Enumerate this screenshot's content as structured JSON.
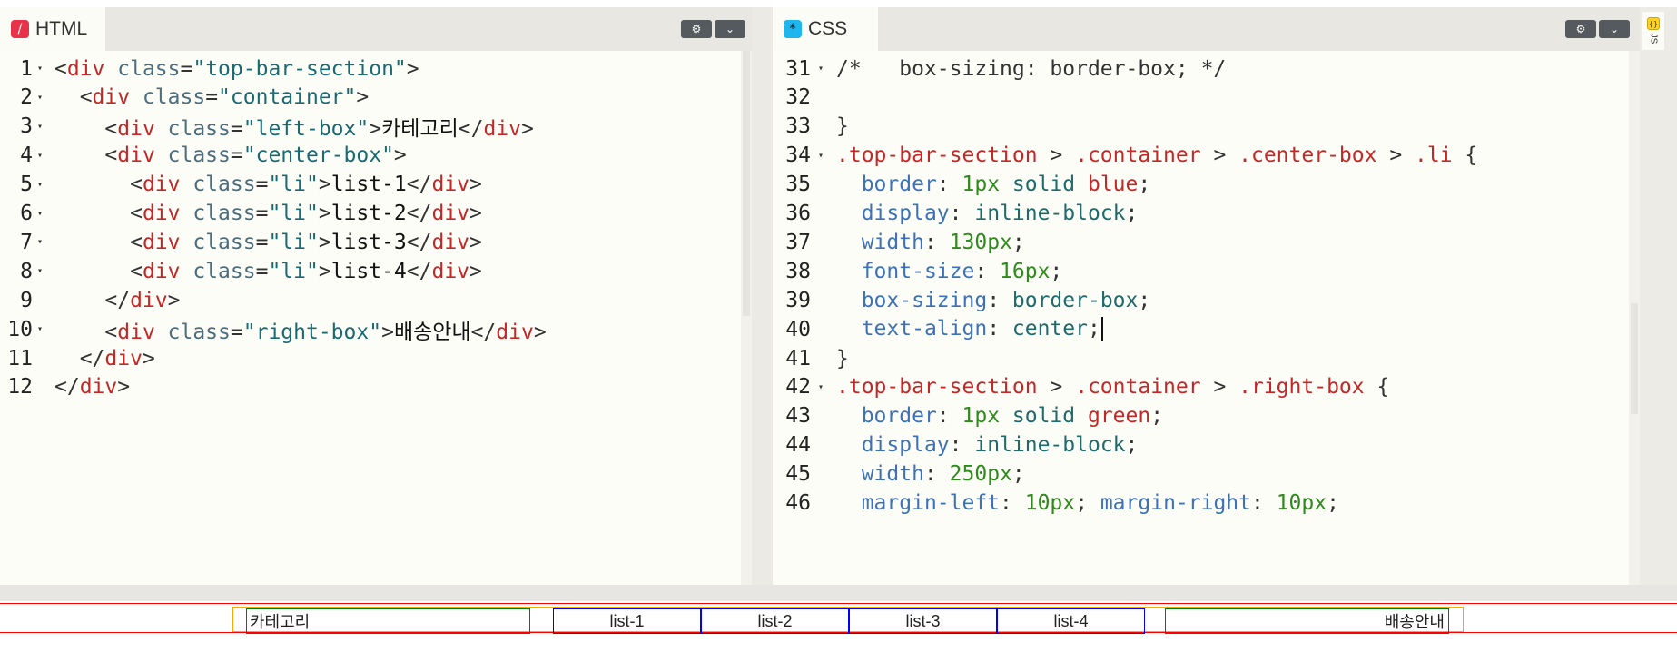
{
  "html_panel": {
    "title": "HTML",
    "icon": "html-file-icon",
    "settings_icon": "gear-icon",
    "menu_icon": "chevron-down-icon",
    "lines": [
      {
        "n": "1",
        "fold": true,
        "tokens": [
          [
            "t-p",
            "<"
          ],
          [
            "t-t",
            "div"
          ],
          [
            "t-a",
            " class"
          ],
          [
            "t-p",
            "="
          ],
          [
            "t-s",
            "\"top-bar-section\""
          ],
          [
            "t-p",
            ">"
          ]
        ]
      },
      {
        "n": "2",
        "fold": true,
        "tokens": [
          [
            "t-p",
            "  <"
          ],
          [
            "t-t",
            "div"
          ],
          [
            "t-a",
            " class"
          ],
          [
            "t-p",
            "="
          ],
          [
            "t-s",
            "\"container\""
          ],
          [
            "t-p",
            ">"
          ]
        ]
      },
      {
        "n": "3",
        "fold": true,
        "tokens": [
          [
            "t-p",
            "    <"
          ],
          [
            "t-t",
            "div"
          ],
          [
            "t-a",
            " class"
          ],
          [
            "t-p",
            "="
          ],
          [
            "t-s",
            "\"left-box\""
          ],
          [
            "t-p",
            ">"
          ],
          [
            "t-x",
            "카테고리"
          ],
          [
            "t-p",
            "</"
          ],
          [
            "t-t",
            "div"
          ],
          [
            "t-p",
            ">"
          ]
        ]
      },
      {
        "n": "4",
        "fold": true,
        "tokens": [
          [
            "t-p",
            "    <"
          ],
          [
            "t-t",
            "div"
          ],
          [
            "t-a",
            " class"
          ],
          [
            "t-p",
            "="
          ],
          [
            "t-s",
            "\"center-box\""
          ],
          [
            "t-p",
            ">"
          ]
        ]
      },
      {
        "n": "5",
        "fold": true,
        "tokens": [
          [
            "t-p",
            "      <"
          ],
          [
            "t-t",
            "div"
          ],
          [
            "t-a",
            " class"
          ],
          [
            "t-p",
            "="
          ],
          [
            "t-s",
            "\"li\""
          ],
          [
            "t-p",
            ">"
          ],
          [
            "t-x",
            "list-1"
          ],
          [
            "t-p",
            "</"
          ],
          [
            "t-t",
            "div"
          ],
          [
            "t-p",
            ">"
          ]
        ]
      },
      {
        "n": "6",
        "fold": true,
        "tokens": [
          [
            "t-p",
            "      <"
          ],
          [
            "t-t",
            "div"
          ],
          [
            "t-a",
            " class"
          ],
          [
            "t-p",
            "="
          ],
          [
            "t-s",
            "\"li\""
          ],
          [
            "t-p",
            ">"
          ],
          [
            "t-x",
            "list-2"
          ],
          [
            "t-p",
            "</"
          ],
          [
            "t-t",
            "div"
          ],
          [
            "t-p",
            ">"
          ]
        ]
      },
      {
        "n": "7",
        "fold": true,
        "tokens": [
          [
            "t-p",
            "      <"
          ],
          [
            "t-t",
            "div"
          ],
          [
            "t-a",
            " class"
          ],
          [
            "t-p",
            "="
          ],
          [
            "t-s",
            "\"li\""
          ],
          [
            "t-p",
            ">"
          ],
          [
            "t-x",
            "list-3"
          ],
          [
            "t-p",
            "</"
          ],
          [
            "t-t",
            "div"
          ],
          [
            "t-p",
            ">"
          ]
        ]
      },
      {
        "n": "8",
        "fold": true,
        "tokens": [
          [
            "t-p",
            "      <"
          ],
          [
            "t-t",
            "div"
          ],
          [
            "t-a",
            " class"
          ],
          [
            "t-p",
            "="
          ],
          [
            "t-s",
            "\"li\""
          ],
          [
            "t-p",
            ">"
          ],
          [
            "t-x",
            "list-4"
          ],
          [
            "t-p",
            "</"
          ],
          [
            "t-t",
            "div"
          ],
          [
            "t-p",
            ">"
          ]
        ]
      },
      {
        "n": "9",
        "fold": false,
        "tokens": [
          [
            "t-p",
            "    </"
          ],
          [
            "t-t",
            "div"
          ],
          [
            "t-p",
            ">"
          ]
        ]
      },
      {
        "n": "10",
        "fold": true,
        "tokens": [
          [
            "t-p",
            "    <"
          ],
          [
            "t-t",
            "div"
          ],
          [
            "t-a",
            " class"
          ],
          [
            "t-p",
            "="
          ],
          [
            "t-s",
            "\"right-box\""
          ],
          [
            "t-p",
            ">"
          ],
          [
            "t-x",
            "배송안내"
          ],
          [
            "t-p",
            "</"
          ],
          [
            "t-t",
            "div"
          ],
          [
            "t-p",
            ">"
          ]
        ]
      },
      {
        "n": "11",
        "fold": false,
        "tokens": [
          [
            "t-p",
            "  </"
          ],
          [
            "t-t",
            "div"
          ],
          [
            "t-p",
            ">"
          ]
        ]
      },
      {
        "n": "12",
        "fold": false,
        "tokens": [
          [
            "t-p",
            "</"
          ],
          [
            "t-t",
            "div"
          ],
          [
            "t-p",
            ">"
          ]
        ]
      }
    ]
  },
  "css_panel": {
    "title": "CSS",
    "icon": "css-file-icon",
    "settings_icon": "gear-icon",
    "menu_icon": "chevron-down-icon",
    "lines": [
      {
        "n": "31",
        "fold": true,
        "tokens": [
          [
            "t-cm",
            "/*   box-sizing: border-box; */"
          ]
        ]
      },
      {
        "n": "32",
        "fold": false,
        "tokens": []
      },
      {
        "n": "33",
        "fold": false,
        "tokens": [
          [
            "t-p",
            "}"
          ]
        ]
      },
      {
        "n": "34",
        "fold": true,
        "tokens": [
          [
            "t-sel",
            ".top-bar-section"
          ],
          [
            "t-p",
            " > "
          ],
          [
            "t-sel",
            ".container"
          ],
          [
            "t-p",
            " > "
          ],
          [
            "t-sel",
            ".center-box"
          ],
          [
            "t-p",
            " > "
          ],
          [
            "t-sel",
            ".li"
          ],
          [
            "t-p",
            " {"
          ]
        ]
      },
      {
        "n": "35",
        "fold": false,
        "tokens": [
          [
            "t-p",
            "  "
          ],
          [
            "t-prop",
            "border"
          ],
          [
            "t-p",
            ": "
          ],
          [
            "t-num",
            "1px"
          ],
          [
            "t-val",
            " solid "
          ],
          [
            "t-col",
            "blue"
          ],
          [
            "t-p",
            ";"
          ]
        ]
      },
      {
        "n": "36",
        "fold": false,
        "tokens": [
          [
            "t-p",
            "  "
          ],
          [
            "t-prop",
            "display"
          ],
          [
            "t-p",
            ": "
          ],
          [
            "t-val",
            "inline-block"
          ],
          [
            "t-p",
            ";"
          ]
        ]
      },
      {
        "n": "37",
        "fold": false,
        "tokens": [
          [
            "t-p",
            "  "
          ],
          [
            "t-prop",
            "width"
          ],
          [
            "t-p",
            ": "
          ],
          [
            "t-num",
            "130px"
          ],
          [
            "t-p",
            ";"
          ]
        ]
      },
      {
        "n": "38",
        "fold": false,
        "tokens": [
          [
            "t-p",
            "  "
          ],
          [
            "t-prop",
            "font-size"
          ],
          [
            "t-p",
            ": "
          ],
          [
            "t-num",
            "16px"
          ],
          [
            "t-p",
            ";"
          ]
        ]
      },
      {
        "n": "39",
        "fold": false,
        "tokens": [
          [
            "t-p",
            "  "
          ],
          [
            "t-prop",
            "box-sizing"
          ],
          [
            "t-p",
            ": "
          ],
          [
            "t-val",
            "border-box"
          ],
          [
            "t-p",
            ";"
          ]
        ]
      },
      {
        "n": "40",
        "fold": false,
        "cursor": true,
        "tokens": [
          [
            "t-p",
            "  "
          ],
          [
            "t-prop",
            "text-align"
          ],
          [
            "t-p",
            ": "
          ],
          [
            "t-val",
            "center"
          ],
          [
            "t-p",
            ";"
          ]
        ]
      },
      {
        "n": "41",
        "fold": false,
        "tokens": [
          [
            "t-p",
            "}"
          ]
        ]
      },
      {
        "n": "42",
        "fold": true,
        "tokens": [
          [
            "t-sel",
            ".top-bar-section"
          ],
          [
            "t-p",
            " > "
          ],
          [
            "t-sel",
            ".container"
          ],
          [
            "t-p",
            " > "
          ],
          [
            "t-sel",
            ".right-box"
          ],
          [
            "t-p",
            " {"
          ]
        ]
      },
      {
        "n": "43",
        "fold": false,
        "tokens": [
          [
            "t-p",
            "  "
          ],
          [
            "t-prop",
            "border"
          ],
          [
            "t-p",
            ": "
          ],
          [
            "t-num",
            "1px"
          ],
          [
            "t-val",
            " solid "
          ],
          [
            "t-col",
            "green"
          ],
          [
            "t-p",
            ";"
          ]
        ]
      },
      {
        "n": "44",
        "fold": false,
        "tokens": [
          [
            "t-p",
            "  "
          ],
          [
            "t-prop",
            "display"
          ],
          [
            "t-p",
            ": "
          ],
          [
            "t-val",
            "inline-block"
          ],
          [
            "t-p",
            ";"
          ]
        ]
      },
      {
        "n": "45",
        "fold": false,
        "tokens": [
          [
            "t-p",
            "  "
          ],
          [
            "t-prop",
            "width"
          ],
          [
            "t-p",
            ": "
          ],
          [
            "t-num",
            "250px"
          ],
          [
            "t-p",
            ";"
          ]
        ]
      },
      {
        "n": "46",
        "fold": false,
        "tokens": [
          [
            "t-p",
            "  "
          ],
          [
            "t-prop",
            "margin-left"
          ],
          [
            "t-p",
            ": "
          ],
          [
            "t-num",
            "10px"
          ],
          [
            "t-p",
            "; "
          ],
          [
            "t-prop",
            "margin-right"
          ],
          [
            "t-p",
            ": "
          ],
          [
            "t-num",
            "10px"
          ],
          [
            "t-p",
            ";"
          ]
        ]
      }
    ]
  },
  "js_panel": {
    "label": "JS",
    "icon": "js-file-icon"
  },
  "preview": {
    "left_box": "카테고리",
    "list_items": [
      "list-1",
      "list-2",
      "list-3",
      "list-4"
    ],
    "right_box": "배송안내"
  },
  "colors": {
    "section_border": "#ff0000",
    "container_border": "#ffa500",
    "side_box_border": "#008000",
    "list_border": "#0000ff"
  }
}
